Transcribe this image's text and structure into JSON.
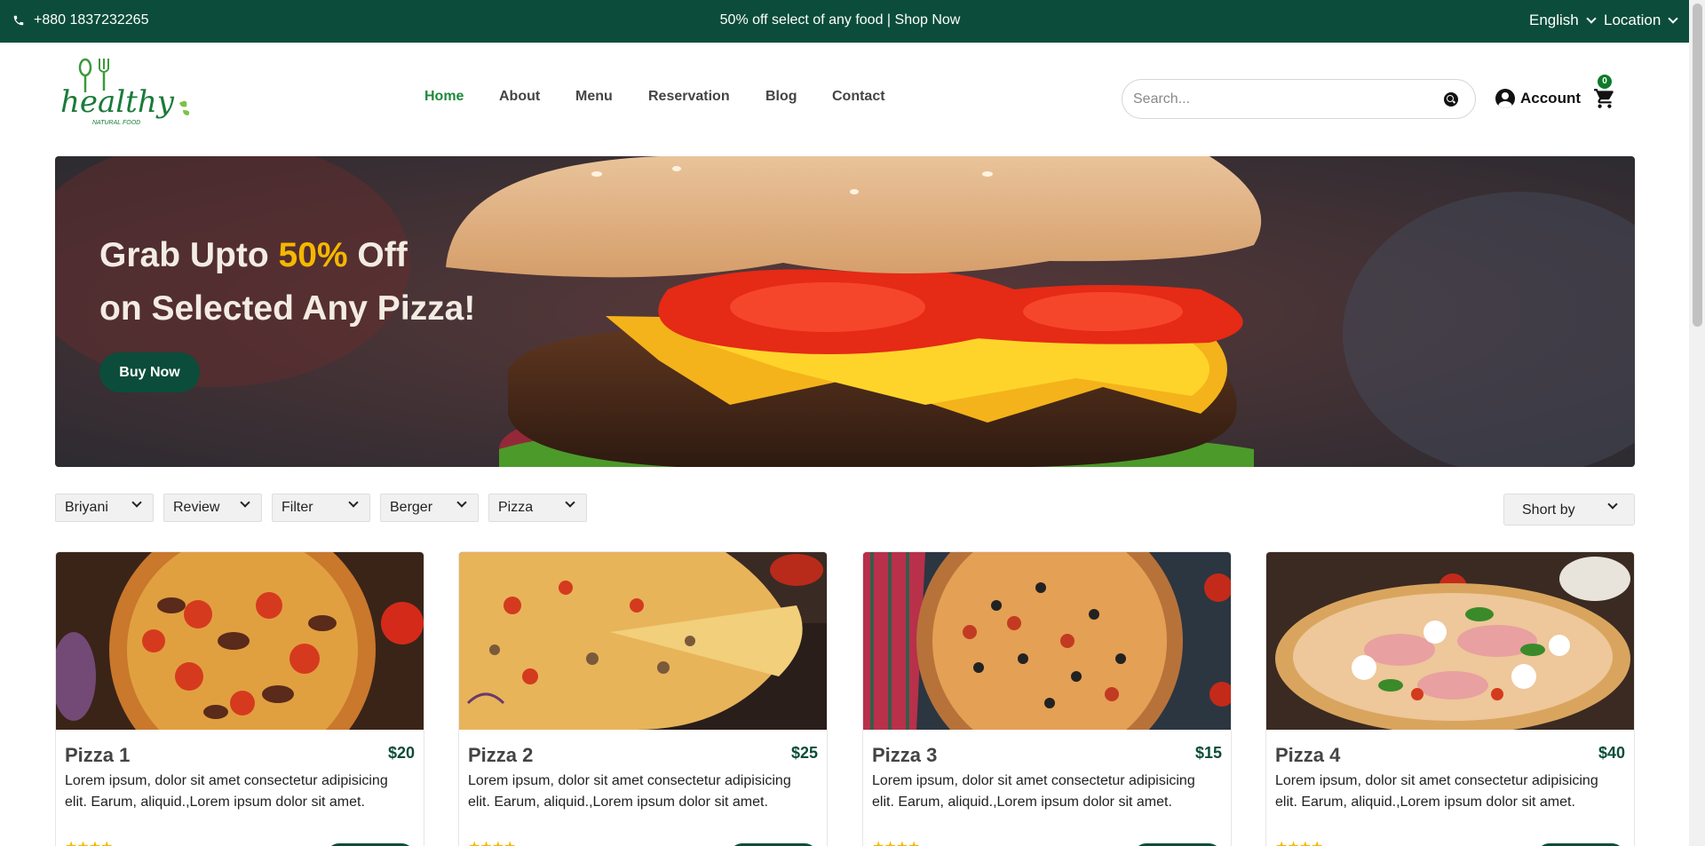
{
  "topbar": {
    "phone": "+880 1837232265",
    "promo": "50% off select of any food | Shop Now",
    "language": "English",
    "location": "Location"
  },
  "logo": {
    "text": "healthy",
    "tagline": "NATURAL FOOD"
  },
  "nav": {
    "items": [
      {
        "label": "Home",
        "active": true
      },
      {
        "label": "About"
      },
      {
        "label": "Menu"
      },
      {
        "label": "Reservation"
      },
      {
        "label": "Blog"
      },
      {
        "label": "Contact"
      }
    ]
  },
  "search": {
    "placeholder": "Search..."
  },
  "account": {
    "label": "Account"
  },
  "cart": {
    "count": "0"
  },
  "hero": {
    "line1_before": "Grab Upto ",
    "line1_highlight": "50%",
    "line1_after": " Off",
    "line2": "on Selected Any Pizza!",
    "button": "Buy Now"
  },
  "filters": [
    "Briyani",
    "Review",
    "Filter",
    "Berger",
    "Pizza"
  ],
  "sort": {
    "label": "Short by"
  },
  "products": [
    {
      "name": "Pizza 1",
      "price": "$20",
      "description": "Lorem ipsum, dolor sit amet consectetur adipisicing elit. Earum, aliquid.,Lorem ipsum dolor sit amet.",
      "rating": 4
    },
    {
      "name": "Pizza 2",
      "price": "$25",
      "description": "Lorem ipsum, dolor sit amet consectetur adipisicing elit. Earum, aliquid.,Lorem ipsum dolor sit amet.",
      "rating": 4
    },
    {
      "name": "Pizza 3",
      "price": "$15",
      "description": "Lorem ipsum, dolor sit amet consectetur adipisicing elit. Earum, aliquid.,Lorem ipsum dolor sit amet.",
      "rating": 4
    },
    {
      "name": "Pizza 4",
      "price": "$40",
      "description": "Lorem ipsum, dolor sit amet consectetur adipisicing elit. Earum, aliquid.,Lorem ipsum dolor sit amet.",
      "rating": 4
    }
  ],
  "colors": {
    "brand_dark": "#0b4d3a",
    "nav_active": "#1c8a3a",
    "accent_yellow": "#f5b800"
  }
}
